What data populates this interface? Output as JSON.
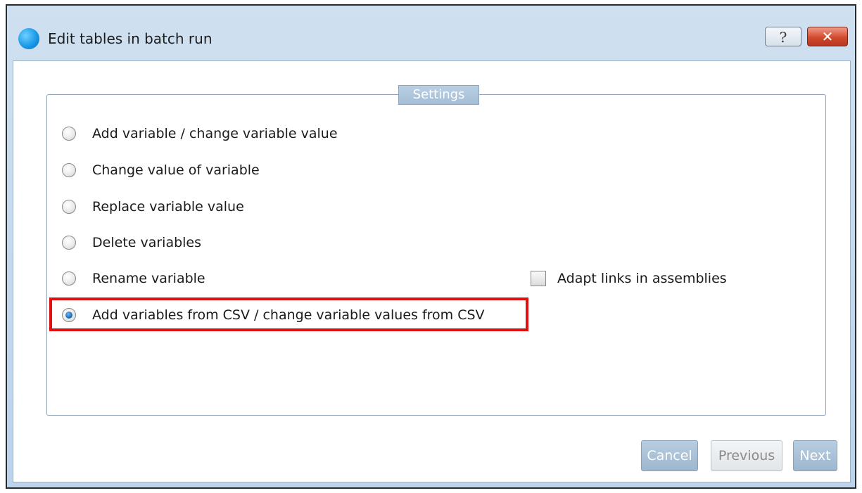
{
  "window": {
    "title": "Edit tables in batch run",
    "help_label": "?",
    "close_label": "✕"
  },
  "settings": {
    "legend": "Settings",
    "options": [
      {
        "label": "Add variable / change variable value",
        "selected": false
      },
      {
        "label": "Change value of variable",
        "selected": false
      },
      {
        "label": "Replace variable value",
        "selected": false
      },
      {
        "label": "Delete variables",
        "selected": false
      },
      {
        "label": "Rename variable",
        "selected": false
      },
      {
        "label": "Add variables from CSV / change variable values from CSV",
        "selected": true
      }
    ],
    "adapt_links": {
      "label": "Adapt links in assemblies",
      "checked": false
    }
  },
  "buttons": {
    "cancel": "Cancel",
    "previous": "Previous",
    "next": "Next"
  },
  "colors": {
    "highlight": "#e01010",
    "accent": "#1d6ec0"
  }
}
